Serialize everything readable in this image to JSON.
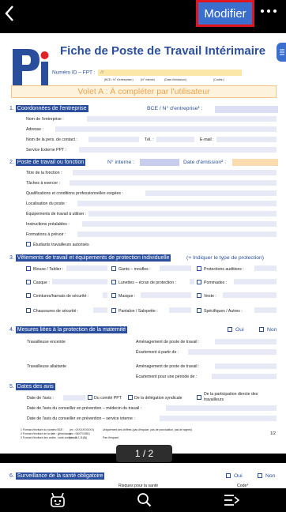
{
  "topbar": {
    "back_icon": "chevron-left-icon",
    "modify_label": "Modifier",
    "more_icon": "more-dots-icon"
  },
  "doc": {
    "title": "Fiche de Poste de Travail Intérimaire",
    "numero_label": "Numéro ID – FPT :",
    "numero_value": "///",
    "micro1": "(BCE / N° d'entreprise¹)",
    "micro2": "(N° interne)",
    "micro3": "(Date d'émission²)",
    "micro4": "(Codes³)",
    "volet": "Volet A : À compléter par l'utilisateur",
    "s1_num": "1.",
    "s1_title": "Coordonnées de l'entreprise",
    "s1_bce": "BCE / N° d'entreprise¹ :",
    "s1_fields": [
      "Nom de l'entreprise :",
      "Adresse :",
      "Nom de la pers. de contact :",
      "Service Externe PPT :"
    ],
    "s1_tel": "Tél. :",
    "s1_email": "E-mail :",
    "s2_num": "2.",
    "s2_title": "Poste de travail ou fonction",
    "s2_interne": "N° interne :",
    "s2_date": "Date d'émission² :",
    "s2_fields": [
      "Titre de la fonction :",
      "Tâches à exercer :",
      "Qualifications et conditions professionnelles exigées :",
      "Localisation du poste :",
      "Équipements de travail à utiliser :",
      "Instructions préalables :",
      "Formations à prévoir :"
    ],
    "s2_students": "Étudiants travailleurs autorisés",
    "s3_num": "3.",
    "s3_title": "Vêtements de travail et équipements de protection individuelle",
    "s3_hint": "(+ Indiquer le type de protection)",
    "s3_items": [
      "Blouse / Tablier :",
      "Gants – moufles :",
      "Protections auditives :",
      "Casque :",
      "Lunettes – écran de protection :",
      "Pommades :",
      "Ceintures/harnais de sécurité :",
      "Masque :",
      "Veste :",
      "Chaussures de sécurité :",
      "Pantalon / Salopette :",
      "Spécifiques / Autres :"
    ],
    "s4_num": "4.",
    "s4_title": "Mesures liées à la protection de la maternité",
    "s4_oui": "Oui",
    "s4_non": "Non",
    "s4_enceinte": "Travailleuse enceinte",
    "s4_allaitante": "Travailleuse allaitante",
    "s4_amenagement": "Aménagement de poste de travail :",
    "s4_ecartement_partir": "Écartement à partir de :",
    "s4_ecartement_periode": "Écartement pour une période de :",
    "s5_num": "5.",
    "s5_title": "Dates des avis",
    "s5_date_avis": "Date de l'avis :",
    "s5_cppt": "Du comité PPT",
    "s5_delegation": "De la délégation syndicale",
    "s5_directe": "De la participation directe des travailleurs",
    "s5_medecin": "Date de l'avis du conseiller en prévention – médecin du travail :",
    "s5_service": "Date de l'avis du conseiller en prévention – service interne :",
    "foot1": "1 Format d'écriture du numéro BCE :",
    "foot1b": "(ex : 0XXXXXXXXX)",
    "foot1c": "Uniquement des chiffres (pas d'espace, pas de ponctuation, pas de signes)",
    "foot2": "2 Format d'écriture de la date : jj/mm/aaaa",
    "foot2b": "(ex : 06/07/1981)",
    "foot3": "3 Format d'écriture des codes : code,code,code",
    "foot3b": "(ex : 1,2,11(8))",
    "foot3c": "Pas d'espace",
    "page_num": "1/2",
    "s6_num": "6.",
    "s6_title": "Surveillance de la santé obligatoire",
    "s6_oui": "Oui",
    "s6_non": "Non",
    "s6_risques": "Risques pour la santé",
    "s6_code": "Code⁴"
  },
  "pager": {
    "label": "1 / 2"
  },
  "bottom": {
    "icon1": "robot-icon",
    "icon2": "search-icon",
    "icon3": "menu-list-icon"
  },
  "colors": {
    "accent": "#2a4e9c",
    "button": "#3a6fcf",
    "highlight": "#e0161f",
    "volet": "#f0a24a"
  }
}
